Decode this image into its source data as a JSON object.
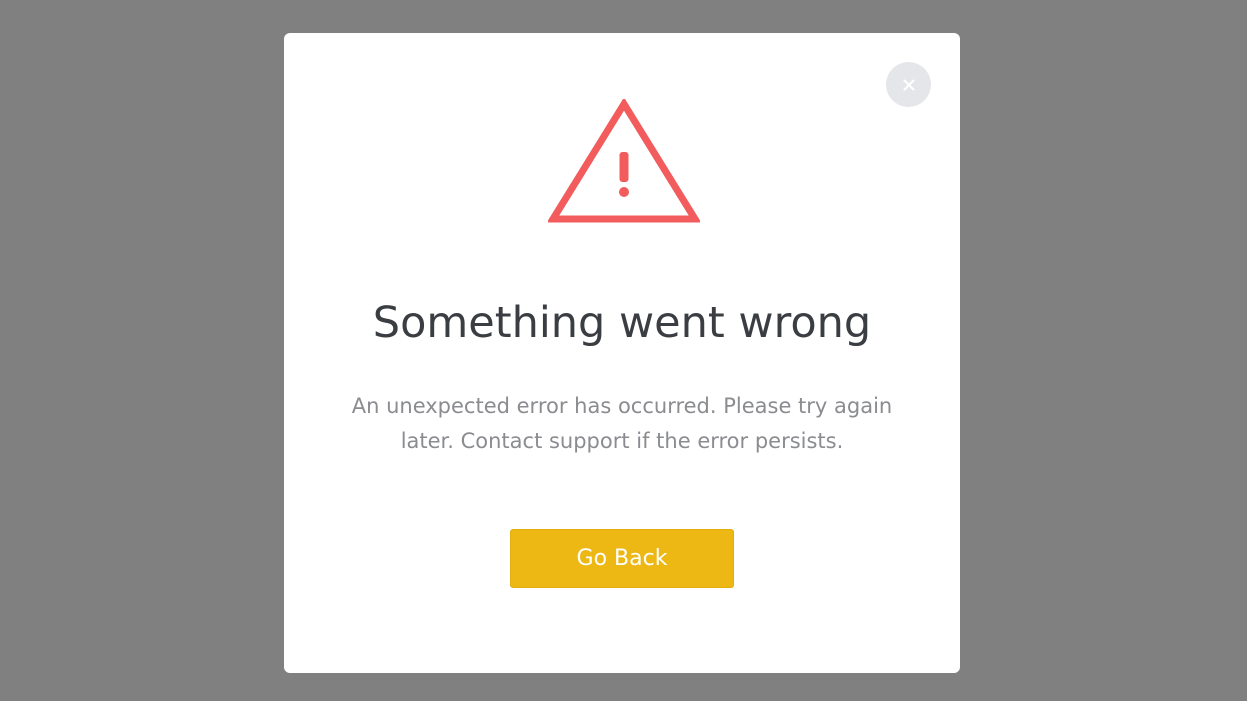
{
  "modal": {
    "title": "Something went wrong",
    "message": "An unexpected error has occurred. Please try again later. Contact support if the error persists.",
    "primary_button_label": "Go Back",
    "close_icon": "close-icon",
    "warning_icon": "warning-triangle-icon"
  },
  "colors": {
    "backdrop": "#808080",
    "modal_background": "#ffffff",
    "warning": "#f25c5c",
    "button": "#edb714",
    "title_text": "#3a3d42",
    "message_text": "#8a8c90",
    "close_button_bg": "#e4e6ea"
  }
}
